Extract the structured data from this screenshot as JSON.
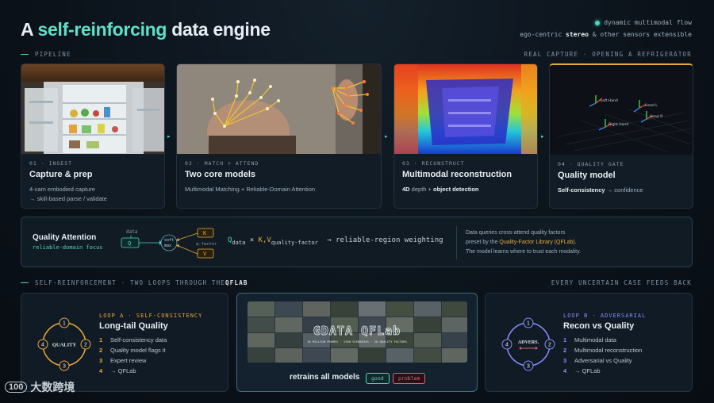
{
  "header": {
    "title_pre": "A ",
    "title_highlight": "self-reinforcing",
    "title_post": " data engine",
    "top_right_line1": "dynamic multimodal flow",
    "top_right_line2_pre": "ego-centric ",
    "top_right_line2_bold": "stereo",
    "top_right_line2_post": " & other sensors extensible"
  },
  "pipeline": {
    "label": "PIPELINE",
    "right_label": "REAL CAPTURE · OPENING A REFRIGERATOR",
    "steps": [
      {
        "num": "01 · INGEST",
        "name": "Capture & prep",
        "desc_line1": "4-cam embodied capture",
        "desc_line2": "→ skill-based parse / validate"
      },
      {
        "num": "02 · MATCH + ATTEND",
        "name": "Two core models",
        "desc_line1": "Multimodal Matching + Reliable-Domain Attention"
      },
      {
        "num": "03 · RECONSTRUCT",
        "name": "Multimodal reconstruction",
        "desc_bold1": "4D",
        "desc_mid": " depth + ",
        "desc_bold2": "object detection"
      },
      {
        "num": "04 · QUALITY GATE",
        "name": "Quality model",
        "desc_bold1": "Self-consistency",
        "desc_mid": " → confidence"
      }
    ],
    "scene_labels": {
      "left_hand": "Left Hand",
      "right_hand": "Right Hand",
      "head_l": "Head L",
      "head_r": "Head R"
    }
  },
  "quality_attention": {
    "title": "Quality Attention",
    "subtitle": "reliable-domain focus",
    "data_label": "data",
    "q": "Q",
    "softmax_top": "soft",
    "softmax_bottom": "max",
    "k": "K",
    "v": "V",
    "q_factor": "q-factor",
    "formula_q": "Q",
    "formula_q_sub": "data",
    "formula_times": " × ",
    "formula_kv": "K,V",
    "formula_kv_sub": "quality-factor",
    "formula_result": "→  reliable-region weighting",
    "note_line1": "Data queries cross-attend quality factors",
    "note_line2_pre": "preset by the ",
    "note_line2_link": "Quality-Factor Library (QFLab)",
    "note_line2_post": ".",
    "note_line3": "The model learns where to trust each modality."
  },
  "reinforcement": {
    "label_pre": "SELF-REINFORCEMENT · TWO LOOPS THROUGH THE ",
    "label_bold": "QFLAB",
    "right_label": "EVERY UNCERTAIN CASE FEEDS BACK"
  },
  "loop_a": {
    "label": "LOOP A · SELF-CONSISTENCY",
    "title": "Long-tail Quality",
    "center": "QUALITY",
    "steps": [
      "Self-consistency data",
      "Quality model flags it",
      "Expert review",
      "→ QFLab"
    ]
  },
  "center_card": {
    "banner_title": "GDATA QFLab",
    "banner_sub": "10 MILLION FRAMES · 1200 SCENARIOS · 20 QUALITY FACTORS",
    "caption": "retrains all models",
    "tag_good": "good",
    "tag_problem": "problem"
  },
  "loop_b": {
    "label": "LOOP B · ADVERSARIAL",
    "title": "Recon vs Quality",
    "center": "ADVERS.",
    "steps": [
      "Multimodal data",
      "Multimodal reconstruction",
      "Adversarial vs Quality",
      "→ QFLab"
    ]
  },
  "cycle_numbers": [
    "1",
    "2",
    "3",
    "4"
  ],
  "watermark": {
    "logo": "100",
    "text": "大数跨境"
  },
  "colors": {
    "accent": "#4fd6c0",
    "amber": "#e7a83b",
    "violet": "#8a8cff",
    "problem": "#e0607a"
  }
}
